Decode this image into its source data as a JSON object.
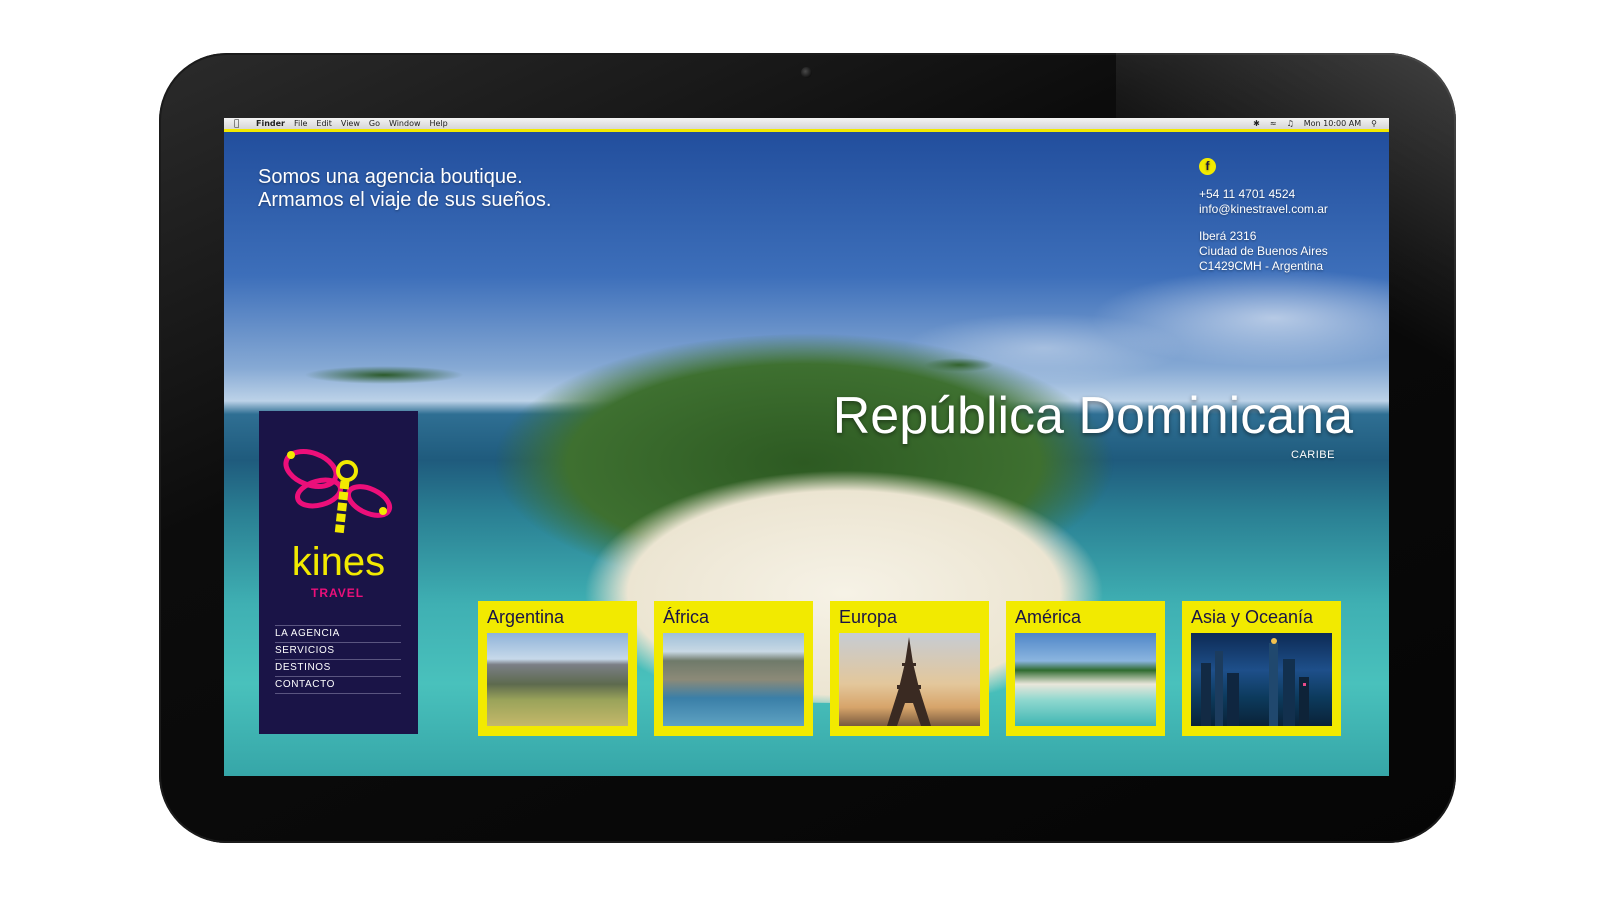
{
  "menubar": {
    "items": [
      "Finder",
      "File",
      "Edit",
      "View",
      "Go",
      "Window",
      "Help"
    ],
    "clock": "Mon 10:00 AM"
  },
  "hero": {
    "tagline_line1": "Somos una agencia boutique.",
    "tagline_line2": "Armamos el viaje de sus sueños.",
    "destination": "República Dominicana",
    "region": "CARIBE"
  },
  "contact": {
    "facebook_icon": "f",
    "phone": "+54 11 4701 4524",
    "email": "info@kinestravel.com.ar",
    "address_line1": "Iberá 2316",
    "address_line2": "Ciudad de Buenos Aires",
    "address_line3": "C1429CMH - Argentina"
  },
  "brand": {
    "name": "kines",
    "sub": "TRAVEL"
  },
  "nav": [
    "LA AGENCIA",
    "SERVICIOS",
    "DESTINOS",
    "CONTACTO"
  ],
  "regions": [
    "Argentina",
    "África",
    "Europa",
    "América",
    "Asia y Oceanía"
  ],
  "colors": {
    "accent_yellow": "#f2ea00",
    "panel_navy": "#1a1447",
    "brand_magenta": "#ec0f7a"
  }
}
